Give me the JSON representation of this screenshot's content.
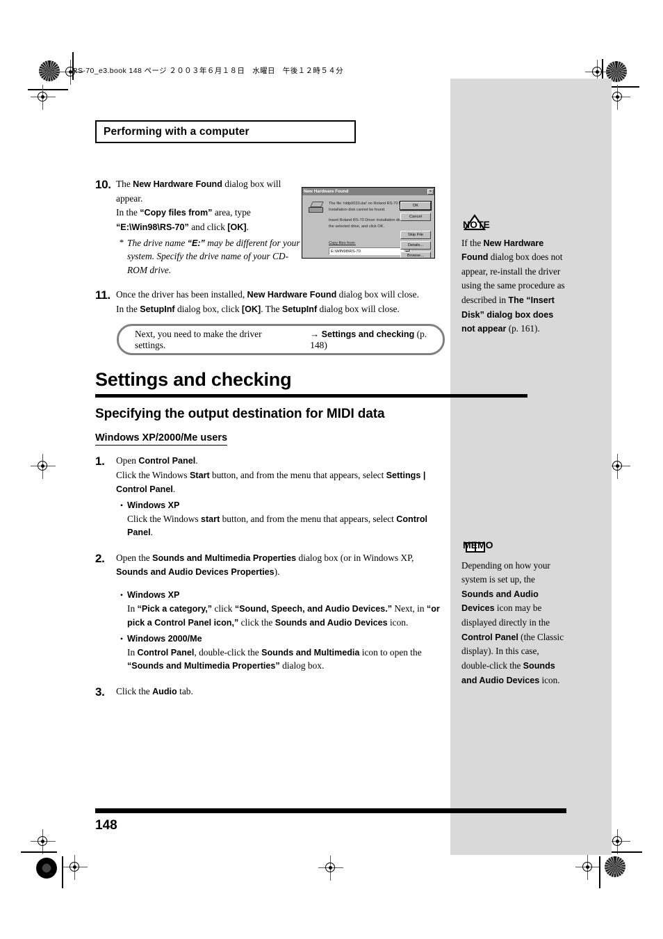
{
  "page": {
    "book_meta": "RS-70_e3.book  148 ページ  ２００３年６月１８日　水曜日　午後１２時５４分",
    "chapter_title": "Performing with a computer",
    "page_number": "148"
  },
  "steps_top": [
    {
      "num": "10.",
      "lines": [
        {
          "parts": [
            {
              "t": "The ",
              "b": false
            },
            {
              "t": "New Hardware Found",
              "b": true
            },
            {
              "t": " dialog box will",
              "b": false
            }
          ]
        },
        {
          "parts": [
            {
              "t": "appear.",
              "b": false
            }
          ]
        },
        {
          "parts": [
            {
              "t": "In the ",
              "b": false
            },
            {
              "t": "“Copy files from”",
              "b": true
            },
            {
              "t": " area, type",
              "b": false
            }
          ]
        },
        {
          "parts": [
            {
              "t": "“E:\\Win98\\RS-70”",
              "b": true
            },
            {
              "t": " and click ",
              "b": false
            },
            {
              "t": "[OK]",
              "b": true
            },
            {
              "t": ".",
              "b": false
            }
          ]
        }
      ],
      "footnote": [
        {
          "t": "The drive name ",
          "b": false
        },
        {
          "t": "“E:”",
          "b": true
        },
        {
          "t": " may be different for your system. Specify the drive name of your CD-ROM drive.",
          "b": false
        }
      ],
      "footnote_marker": "*"
    },
    {
      "num": "11.",
      "lines": [
        {
          "parts": [
            {
              "t": "Once the driver has been installed, ",
              "b": false
            },
            {
              "t": "New Hardware Found",
              "b": true
            },
            {
              "t": " dialog box will close.",
              "b": false
            }
          ]
        },
        {
          "parts": [
            {
              "t": "In the ",
              "b": false
            },
            {
              "t": "SetupInf",
              "b": true
            },
            {
              "t": " dialog box, click ",
              "b": false
            },
            {
              "t": "[OK]",
              "b": true
            },
            {
              "t": ". The ",
              "b": false
            },
            {
              "t": "SetupInf",
              "b": true
            },
            {
              "t": " dialog box will close.",
              "b": false
            }
          ]
        }
      ]
    }
  ],
  "dialog": {
    "title": "New Hardware Found",
    "icon": "disk-drive-icon",
    "message_1": "The file 'rddp0033.dat' on Roland RS-70 Driver Installation disk cannot be found.",
    "message_2": "Insert Roland RS-70 Driver Installation disk in the selected drive, and click OK.",
    "copy_files_label": "Copy files from:",
    "path_value": "E:\\WIN98\\RS-70",
    "dropdown_icon": "chevron-down-icon",
    "buttons": [
      {
        "label": "OK",
        "default": true
      },
      {
        "label": "Cancel",
        "default": false
      },
      {
        "label": "Skip File",
        "default": false
      },
      {
        "label": "Details...",
        "default": false
      },
      {
        "label": "Browse...",
        "default": false
      }
    ],
    "close_icon": "close-icon",
    "close_glyph": "×"
  },
  "callout": {
    "text": "Next, you need to make the driver settings.",
    "arrow": "→",
    "link_label": "Settings and checking",
    "page_ref": "(p. 148)"
  },
  "headings": {
    "h1": "Settings and checking",
    "h2": "Specifying the output destination for MIDI data",
    "h3": "Windows XP/2000/Me users"
  },
  "steps_bottom": [
    {
      "num": "1.",
      "lines": [
        {
          "parts": [
            {
              "t": "Open ",
              "b": false
            },
            {
              "t": "Control Panel",
              "b": true
            },
            {
              "t": ".",
              "b": false
            }
          ]
        },
        {
          "parts": [
            {
              "t": "Click the Windows ",
              "b": false
            },
            {
              "t": "Start",
              "b": true
            },
            {
              "t": " button, and from the menu that appears, select ",
              "b": false
            },
            {
              "t": "Settings | Control Panel",
              "b": true
            },
            {
              "t": ".",
              "b": false
            }
          ]
        }
      ],
      "bullets": [
        {
          "label": "Windows XP",
          "paras": [
            {
              "parts": [
                {
                  "t": "Click the Windows ",
                  "b": false
                },
                {
                  "t": "start",
                  "b": true
                },
                {
                  "t": " button, and from the menu that appears, select ",
                  "b": false
                },
                {
                  "t": "Control Panel",
                  "b": true
                },
                {
                  "t": ".",
                  "b": false
                }
              ]
            }
          ]
        }
      ]
    },
    {
      "num": "2.",
      "lines": [
        {
          "parts": [
            {
              "t": "Open the ",
              "b": false
            },
            {
              "t": "Sounds and Multimedia Properties",
              "b": true
            },
            {
              "t": " dialog box (or in Windows XP, ",
              "b": false
            },
            {
              "t": "Sounds and Audio Devices Properties",
              "b": true
            },
            {
              "t": ").",
              "b": false
            }
          ]
        }
      ],
      "bullets": [
        {
          "label": "Windows XP",
          "paras": [
            {
              "parts": [
                {
                  "t": "In ",
                  "b": false
                },
                {
                  "t": "“Pick a category,”",
                  "b": true
                },
                {
                  "t": " click ",
                  "b": false
                },
                {
                  "t": "“Sound, Speech, and Audio Devices.”",
                  "b": true
                },
                {
                  "t": " Next, in ",
                  "b": false
                },
                {
                  "t": "“or pick a Control Panel icon,”",
                  "b": true
                },
                {
                  "t": " click the ",
                  "b": false
                },
                {
                  "t": "Sounds and Audio Devices",
                  "b": true
                },
                {
                  "t": " icon.",
                  "b": false
                }
              ]
            }
          ]
        },
        {
          "label": "Windows 2000/Me",
          "paras": [
            {
              "parts": [
                {
                  "t": "In ",
                  "b": false
                },
                {
                  "t": "Control Panel",
                  "b": true
                },
                {
                  "t": ", double-click the ",
                  "b": false
                },
                {
                  "t": "Sounds and Multimedia",
                  "b": true
                },
                {
                  "t": " icon to open the ",
                  "b": false
                },
                {
                  "t": "“Sounds and Multimedia Properties”",
                  "b": true
                },
                {
                  "t": " dialog box.",
                  "b": false
                }
              ]
            }
          ]
        }
      ]
    },
    {
      "num": "3.",
      "lines": [
        {
          "parts": [
            {
              "t": "Click the ",
              "b": false
            },
            {
              "t": "Audio",
              "b": true
            },
            {
              "t": " tab.",
              "b": false
            }
          ]
        }
      ],
      "bullets": []
    }
  ],
  "sidebar": {
    "note": {
      "icon": "note-triangle-icon",
      "icon_label": "NOTE",
      "parts": [
        {
          "t": "If the ",
          "b": false
        },
        {
          "t": "New Hardware Found",
          "b": true
        },
        {
          "t": " dialog box does not appear, re-install the driver using the same procedure as described in ",
          "b": false
        },
        {
          "t": "The “Insert Disk” dialog box does not appear",
          "b": true
        },
        {
          "t": " (p. 161).",
          "b": false
        }
      ]
    },
    "memo": {
      "icon": "memo-book-icon",
      "icon_label": "MEMO",
      "parts": [
        {
          "t": "Depending on how your system is set up, the ",
          "b": false
        },
        {
          "t": "Sounds and Audio Devices",
          "b": true
        },
        {
          "t": " icon may be displayed directly in the ",
          "b": false
        },
        {
          "t": "Control Panel",
          "b": true
        },
        {
          "t": " (the Classic display). In this case, double-click the ",
          "b": false
        },
        {
          "t": "Sounds and Audio Devices",
          "b": true
        },
        {
          "t": " icon.",
          "b": false
        }
      ]
    }
  },
  "colors": {
    "sidebar_gray": "#d9d9d9",
    "dialog_face": "#c0c0c0",
    "callout_border": "#808080",
    "rule_black": "#000000"
  }
}
